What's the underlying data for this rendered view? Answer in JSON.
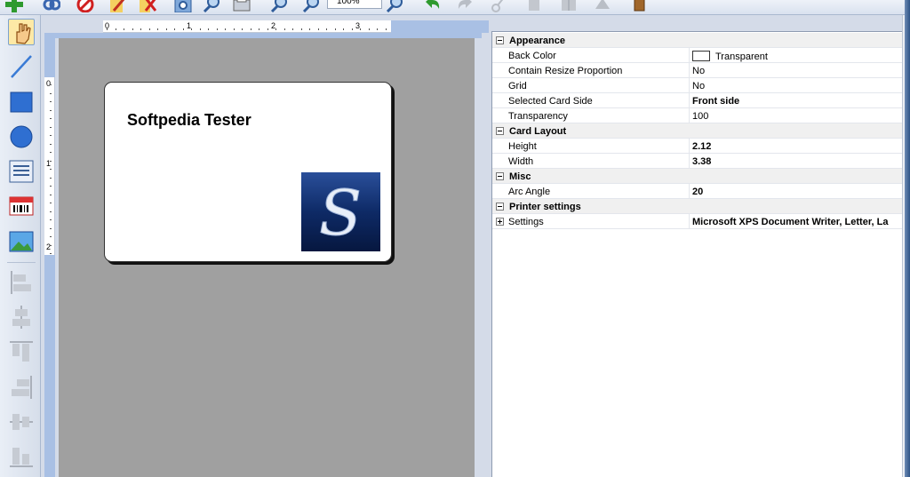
{
  "toolbar": {
    "zoom_value": "100%",
    "icons": [
      "add-icon",
      "link-icon",
      "no-icon",
      "edit-icon",
      "delete-icon",
      "settings-icon",
      "zoom-fit-icon",
      "print-icon",
      "zoom-in-icon",
      "zoom-out-icon",
      "zoom-icon",
      "undo-icon",
      "redo-icon",
      "cut-icon",
      "copy-icon",
      "paste-icon",
      "erase-icon",
      "exit-icon"
    ]
  },
  "left_tools": [
    "select-tool",
    "line-tool",
    "rectangle-tool",
    "ellipse-tool",
    "text-tool",
    "barcode-tool",
    "image-tool",
    "align-left-tool",
    "align-center-tool",
    "align-top-tool",
    "align-right-tool",
    "align-middle-tool",
    "align-bottom-tool"
  ],
  "ruler": {
    "h_labels": [
      "0",
      "1",
      "2",
      "3"
    ],
    "v_labels": [
      "0",
      "1",
      "2"
    ]
  },
  "card": {
    "text": "Softpedia Tester",
    "logo_letter": "S"
  },
  "properties": {
    "categories": [
      {
        "name": "Appearance",
        "rows": [
          {
            "name": "Back Color",
            "value": "Transparent",
            "bold": false,
            "swatch": true
          },
          {
            "name": "Contain Resize Proportion",
            "value": "No",
            "bold": false
          },
          {
            "name": "Grid",
            "value": "No",
            "bold": false
          },
          {
            "name": "Selected Card Side",
            "value": "Front side",
            "bold": true
          },
          {
            "name": "Transparency",
            "value": "100",
            "bold": false
          }
        ]
      },
      {
        "name": "Card Layout",
        "rows": [
          {
            "name": "Height",
            "value": "2.12",
            "bold": true
          },
          {
            "name": "Width",
            "value": "3.38",
            "bold": true
          }
        ]
      },
      {
        "name": "Misc",
        "rows": [
          {
            "name": "Arc Angle",
            "value": "20",
            "bold": true
          }
        ]
      },
      {
        "name": "Printer settings",
        "rows": [
          {
            "name": "Settings",
            "value": "Microsoft XPS Document Writer, Letter, La",
            "bold": true,
            "expandable": true
          }
        ]
      }
    ]
  }
}
